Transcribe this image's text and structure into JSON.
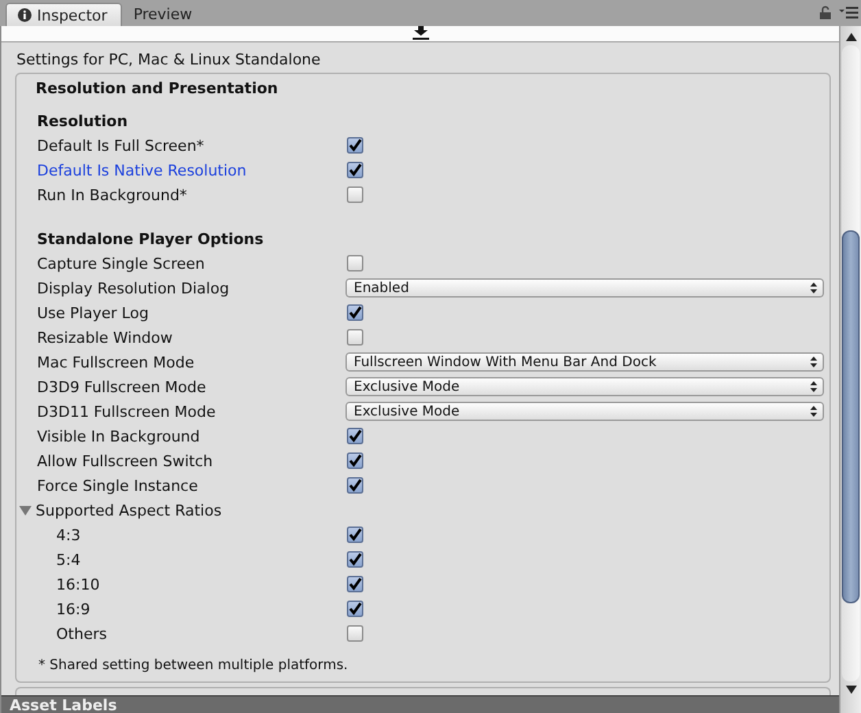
{
  "tabs": [
    {
      "label": "Inspector",
      "selected": true
    },
    {
      "label": "Preview",
      "selected": false
    }
  ],
  "title": "Settings for PC, Mac & Linux Standalone",
  "section": {
    "title": "Resolution and Presentation",
    "groups": [
      {
        "heading": "Resolution",
        "rows": [
          {
            "kind": "checkbox",
            "label": "Default Is Full Screen*",
            "checked": true,
            "highlighted": false
          },
          {
            "kind": "checkbox",
            "label": "Default Is Native Resolution",
            "checked": true,
            "highlighted": true
          },
          {
            "kind": "checkbox",
            "label": "Run In Background*",
            "checked": false,
            "highlighted": false
          }
        ]
      },
      {
        "heading": "Standalone Player Options",
        "rows": [
          {
            "kind": "checkbox",
            "label": "Capture Single Screen",
            "checked": false,
            "highlighted": false
          },
          {
            "kind": "dropdown",
            "label": "Display Resolution Dialog",
            "value": "Enabled"
          },
          {
            "kind": "checkbox",
            "label": "Use Player Log",
            "checked": true,
            "highlighted": false
          },
          {
            "kind": "checkbox",
            "label": "Resizable Window",
            "checked": false,
            "highlighted": false
          },
          {
            "kind": "dropdown",
            "label": "Mac Fullscreen Mode",
            "value": "Fullscreen Window With Menu Bar And Dock"
          },
          {
            "kind": "dropdown",
            "label": "D3D9 Fullscreen Mode",
            "value": "Exclusive Mode"
          },
          {
            "kind": "dropdown",
            "label": "D3D11 Fullscreen Mode",
            "value": "Exclusive Mode"
          },
          {
            "kind": "checkbox",
            "label": "Visible In Background",
            "checked": true,
            "highlighted": false
          },
          {
            "kind": "checkbox",
            "label": "Allow Fullscreen Switch",
            "checked": true,
            "highlighted": false
          },
          {
            "kind": "checkbox",
            "label": "Force Single Instance",
            "checked": true,
            "highlighted": false
          },
          {
            "kind": "foldout",
            "label": "Supported Aspect Ratios",
            "expanded": true,
            "children": [
              {
                "kind": "checkbox",
                "label": "4:3",
                "checked": true,
                "highlighted": false
              },
              {
                "kind": "checkbox",
                "label": "5:4",
                "checked": true,
                "highlighted": false
              },
              {
                "kind": "checkbox",
                "label": "16:10",
                "checked": true,
                "highlighted": false
              },
              {
                "kind": "checkbox",
                "label": "16:9",
                "checked": true,
                "highlighted": false
              },
              {
                "kind": "checkbox",
                "label": "Others",
                "checked": false,
                "highlighted": false
              }
            ]
          }
        ]
      }
    ]
  },
  "footnote": "* Shared setting between multiple platforms.",
  "next_panel": "Asset Labels"
}
